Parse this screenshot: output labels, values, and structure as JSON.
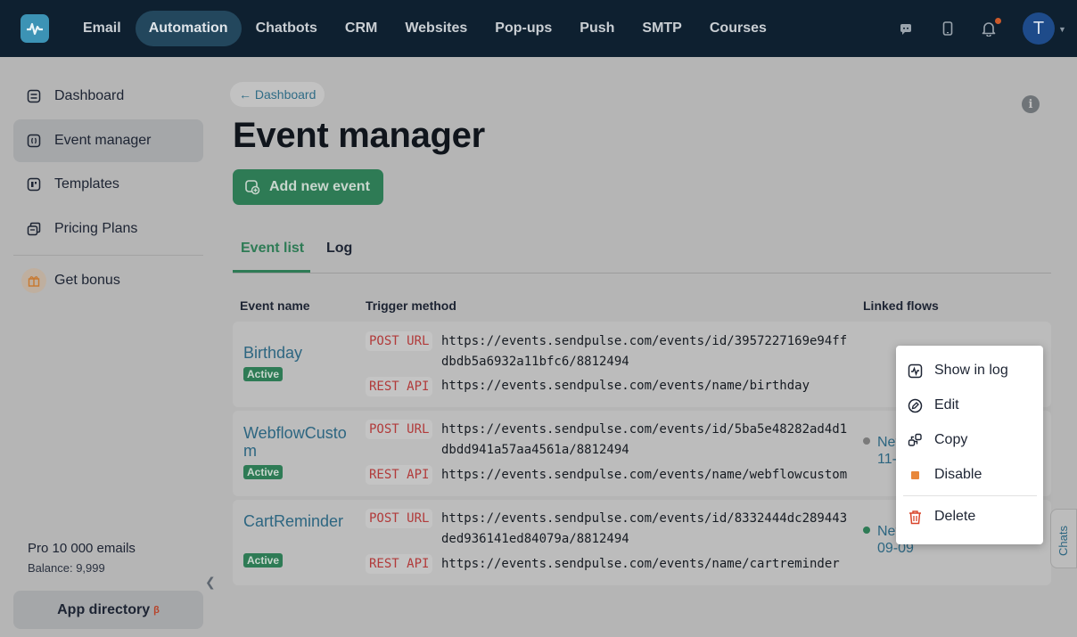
{
  "nav": {
    "items": [
      {
        "label": "Email",
        "active": false
      },
      {
        "label": "Automation",
        "active": true
      },
      {
        "label": "Chatbots",
        "active": false
      },
      {
        "label": "CRM",
        "active": false
      },
      {
        "label": "Websites",
        "active": false
      },
      {
        "label": "Pop-ups",
        "active": false
      },
      {
        "label": "Push",
        "active": false
      },
      {
        "label": "SMTP",
        "active": false
      },
      {
        "label": "Courses",
        "active": false
      }
    ],
    "avatar_letter": "T",
    "icons": [
      "chat-icon",
      "phone-icon",
      "bell-icon"
    ]
  },
  "sidebar": {
    "items": [
      {
        "label": "Dashboard",
        "icon": "dashboard-icon"
      },
      {
        "label": "Event manager",
        "icon": "event-icon"
      },
      {
        "label": "Templates",
        "icon": "templates-icon"
      },
      {
        "label": "Pricing Plans",
        "icon": "pricing-icon"
      }
    ],
    "bonus_label": "Get bonus",
    "plan_name": "Pro 10 000 emails",
    "balance": "Balance: 9,999",
    "app_directory": "App directory",
    "app_directory_sup": "β"
  },
  "main": {
    "breadcrumb": "← Dashboard",
    "title": "Event manager",
    "add_button": "Add new event",
    "tabs": {
      "event_list": "Event list",
      "log": "Log"
    },
    "columns": {
      "event_name": "Event name",
      "trigger_method": "Trigger method",
      "linked_flows": "Linked flows"
    },
    "events": [
      {
        "name": "Birthday",
        "status": "Active",
        "post_label": "POST URL",
        "post_url": "https://events.sendpulse.com/events/id/3957227169e94ffdbdb5a6932a11bfc6/8812494",
        "rest_label": "REST API",
        "rest_url": "https://events.sendpulse.com/events/name/birthday",
        "flow": ""
      },
      {
        "name": "WebflowCustom",
        "status": "Active",
        "post_label": "POST URL",
        "post_url": "https://events.sendpulse.com/events/id/5ba5e48282ad4d1dbdd941a57aa4561a/8812494",
        "rest_label": "REST API",
        "rest_url": "https://events.sendpulse.com/events/name/webflowcustom",
        "flow": "Ne​11-2"
      },
      {
        "name": "CartReminder",
        "status": "Active",
        "post_label": "POST URL",
        "post_url": "https://events.sendpulse.com/events/id/8332444dc289443ded936141ed84079a/8812494",
        "rest_label": "REST API",
        "rest_url": "https://events.sendpulse.com/events/name/cartreminder",
        "flow": "Ne​09-09"
      }
    ],
    "flow_texts": [
      {
        "line1": "Nev",
        "line2": "11-2",
        "dot_color": "#7a7a7a"
      },
      {
        "line1": "Nev",
        "line2": "09-09",
        "dot_color": "#2e7b55"
      }
    ]
  },
  "context_menu": {
    "items": [
      {
        "label": "Show in log",
        "icon": "log-icon"
      },
      {
        "label": "Edit",
        "icon": "edit-icon"
      },
      {
        "label": "Copy",
        "icon": "copy-icon"
      },
      {
        "label": "Disable",
        "icon": "disable-icon"
      },
      {
        "label": "Delete",
        "icon": "trash-icon"
      }
    ]
  },
  "chats_label": "Chats",
  "colors": {
    "accent": "#2e7b55",
    "link": "#2d6681",
    "nav_bg": "#0e2030",
    "method": "#b13a3a",
    "delete": "#d9452b",
    "disable": "#e8873a"
  }
}
